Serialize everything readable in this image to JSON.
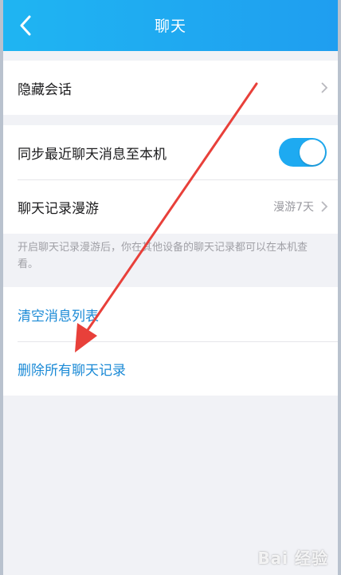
{
  "header": {
    "title": "聊天",
    "back_icon": "chevron-left-icon"
  },
  "group1": {
    "hide_chat_label": "隐藏会话"
  },
  "group2": {
    "sync_label": "同步最近聊天消息至本机",
    "sync_enabled": true,
    "roaming_label": "聊天记录漫游",
    "roaming_value": "漫游7天"
  },
  "hint_text": "开启聊天记录漫游后，你在其他设备的聊天记录都可以在本机查看。",
  "group3": {
    "clear_list_label": "清空消息列表",
    "delete_all_label": "删除所有聊天记录"
  },
  "colors": {
    "header": "#1fa8f1",
    "toggle_on": "#1eaaf1",
    "link": "#1b8ad6",
    "annotation_arrow": "#e8403a"
  },
  "watermark_text": "Bai 经验"
}
